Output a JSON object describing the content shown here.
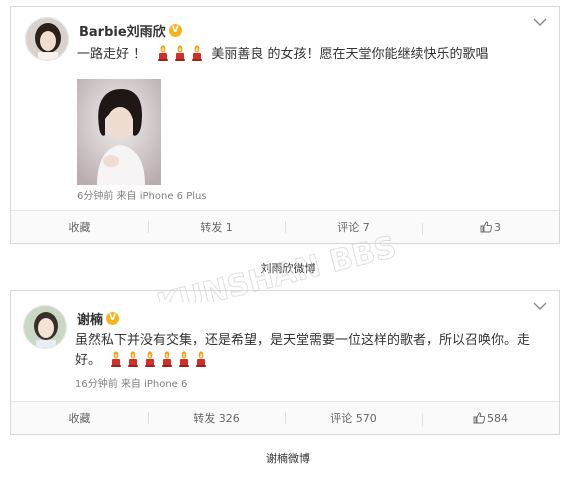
{
  "post1": {
    "author": "Barbie刘雨欣",
    "verified_badge": "V",
    "text_before": "一路走好 ！",
    "candles_a": 3,
    "text_after": "美丽善良 的女孩！愿在天堂你能继续快乐的歌唱",
    "meta": "6分钟前 来自 iPhone 6 Plus",
    "actions": {
      "favorite": "收藏",
      "repost": "转发 1",
      "comment": "评论 7",
      "like": "3"
    }
  },
  "caption1": "刘雨欣微博",
  "post2": {
    "author": "谢楠",
    "verified_badge": "V",
    "line1": "虽然私下并没有交集，还是希望，是天堂需要一位这样的歌者，所以召唤你。走",
    "line2": "好。",
    "candles": 6,
    "meta": "16分钟前 来自 iPhone 6",
    "actions": {
      "favorite": "收藏",
      "repost": "转发 326",
      "comment": "评论 570",
      "like": "584"
    }
  },
  "caption2": "谢楠微博",
  "watermark": "昆山论坛 KUNSHAN BBS",
  "icons": {
    "dropdown": "chevron-down-icon",
    "candle": "candle-emoji-icon",
    "like": "thumbs-up-icon"
  },
  "colors": {
    "badge": "#f5b41e",
    "candle_flame": "#f29c1f",
    "candle_body": "#d0302a",
    "border": "#d8d8d8"
  }
}
